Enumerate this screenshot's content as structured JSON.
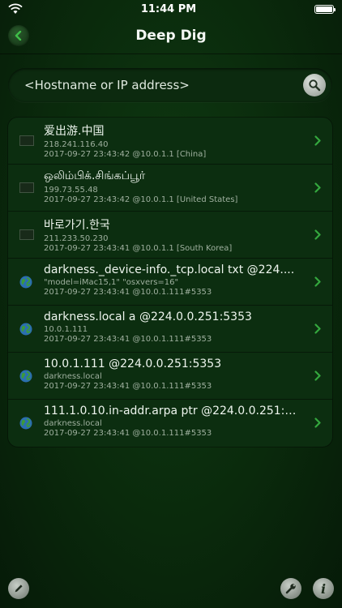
{
  "status_bar": {
    "time": "11:44 PM"
  },
  "nav": {
    "title": "Deep Dig"
  },
  "search": {
    "placeholder": "<Hostname or IP address>"
  },
  "list": {
    "rows": [
      {
        "icon": "flag-china-icon",
        "title": "爱出游.中国",
        "subtitle": "218.241.116.40",
        "meta": "2017-09-27 23:43:42 @10.0.1.1 [China]"
      },
      {
        "icon": "flag-united-states-icon",
        "title": "ஒலிம்பிக்.சிங்கப்பூர்",
        "subtitle": "199.73.55.48",
        "meta": "2017-09-27 23:43:42 @10.0.1.1 [United States]"
      },
      {
        "icon": "flag-south-korea-icon",
        "title": "바로가기.한국",
        "subtitle": "211.233.50.230",
        "meta": "2017-09-27 23:43:41 @10.0.1.1 [South Korea]"
      },
      {
        "icon": "globe-icon",
        "title": "darkness._device-info._tcp.local txt @224....",
        "subtitle": "\"model=iMac15,1\" \"osxvers=16\"",
        "meta": "2017-09-27 23:43:41 @10.0.1.111#5353"
      },
      {
        "icon": "globe-icon",
        "title": "darkness.local a @224.0.0.251:5353",
        "subtitle": "10.0.1.111",
        "meta": "2017-09-27 23:43:41 @10.0.1.111#5353"
      },
      {
        "icon": "globe-icon",
        "title": "10.0.1.111 @224.0.0.251:5353",
        "subtitle": "darkness.local",
        "meta": "2017-09-27 23:43:41 @10.0.1.111#5353"
      },
      {
        "icon": "globe-icon",
        "title": "111.1.0.10.in-addr.arpa ptr @224.0.0.251:5...",
        "subtitle": "darkness.local",
        "meta": "2017-09-27 23:43:41 @10.0.1.111#5353"
      }
    ]
  },
  "toolbar": {
    "left_icon": "pencil-icon",
    "right_icons": [
      "wrench-icon",
      "info-icon"
    ]
  },
  "colors": {
    "accent": "#2f9a3a",
    "background": "#0a2a0c",
    "row_bg": "#0c2e10"
  }
}
